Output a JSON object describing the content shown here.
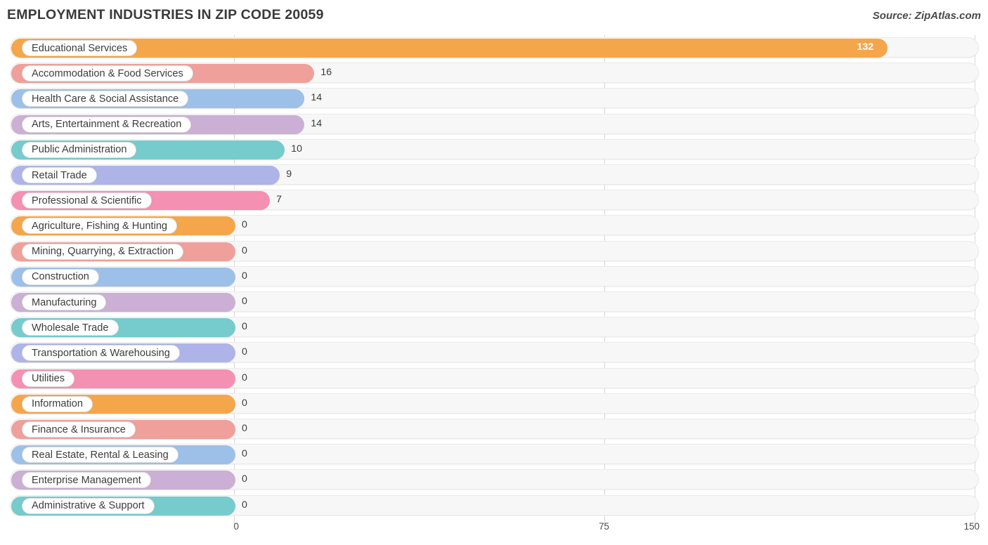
{
  "header": {
    "title": "EMPLOYMENT INDUSTRIES IN ZIP CODE 20059",
    "source": "Source: ZipAtlas.com"
  },
  "chart_data": {
    "type": "bar",
    "orientation": "horizontal",
    "title": "EMPLOYMENT INDUSTRIES IN ZIP CODE 20059",
    "xlabel": "",
    "ylabel": "",
    "xlim": [
      0,
      150
    ],
    "ticks": [
      "0",
      "75",
      "150"
    ],
    "tick_values": [
      0,
      75,
      150
    ],
    "grid": true,
    "legend": false,
    "categories": [
      "Educational Services",
      "Accommodation & Food Services",
      "Health Care & Social Assistance",
      "Arts, Entertainment & Recreation",
      "Public Administration",
      "Retail Trade",
      "Professional & Scientific",
      "Agriculture, Fishing & Hunting",
      "Mining, Quarrying, & Extraction",
      "Construction",
      "Manufacturing",
      "Wholesale Trade",
      "Transportation & Warehousing",
      "Utilities",
      "Information",
      "Finance & Insurance",
      "Real Estate, Rental & Leasing",
      "Enterprise Management",
      "Administrative & Support"
    ],
    "values": [
      132,
      16,
      14,
      14,
      10,
      9,
      7,
      0,
      0,
      0,
      0,
      0,
      0,
      0,
      0,
      0,
      0,
      0,
      0
    ],
    "value_labels": [
      "132",
      "16",
      "14",
      "14",
      "10",
      "9",
      "7",
      "0",
      "0",
      "0",
      "0",
      "0",
      "0",
      "0",
      "0",
      "0",
      "0",
      "0",
      "0"
    ],
    "colors": [
      "#f5a64a",
      "#efa09a",
      "#9cc0e8",
      "#cbafd4",
      "#76cbcc",
      "#aeb4e8",
      "#f490b1"
    ]
  },
  "style": {
    "track_bg": "#f7f7f7",
    "grid_color": "#d8d8d8",
    "text_color": "#3c3c3c"
  }
}
